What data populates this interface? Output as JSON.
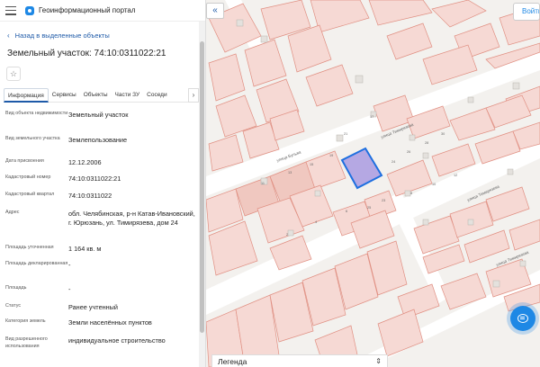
{
  "app": {
    "title": "Геоинформационный портал"
  },
  "nav": {
    "back_label": "Назад в выделенные объекты"
  },
  "object": {
    "title": "Земельный участок: 74:10:0311022:21"
  },
  "tabs": [
    {
      "label": "Информация",
      "active": true
    },
    {
      "label": "Сервисы",
      "active": false
    },
    {
      "label": "Объекты",
      "active": false
    },
    {
      "label": "Части ЗУ",
      "active": false
    },
    {
      "label": "Соседи",
      "active": false
    }
  ],
  "properties": [
    {
      "key": "Вид объекта недвижимости",
      "value": "Земельный участок"
    },
    {
      "key": "Вид земельного участка",
      "value": "Землепользование"
    },
    {
      "key": "Дата присвоения",
      "value": "12.12.2006"
    },
    {
      "key": "Кадастровый номер",
      "value": "74:10:0311022:21"
    },
    {
      "key": "Кадастровый квартал",
      "value": "74:10:0311022"
    },
    {
      "key": "Адрес",
      "value": "обл. Челябинская, р-н Катав-Ивановский, г. Юрюзань, ул. Тимирязева, дом 24"
    },
    {
      "key": "Площадь уточненная",
      "value": "1 164 кв. м"
    },
    {
      "key": "Площадь декларированная",
      "value": "-"
    },
    {
      "key": "Площадь",
      "value": "-"
    },
    {
      "key": "Статус",
      "value": "Ранее учтенный"
    },
    {
      "key": "Категория земель",
      "value": "Земли населённых пунктов"
    },
    {
      "key": "Вид разрешенного использования",
      "value": "индивидуальное строительство"
    }
  ],
  "map": {
    "login_label": "Войти",
    "collapse_symbol": "«",
    "legend_label": "Легенда",
    "legend_arrow": "⇕",
    "streets": [
      "улица Бульва",
      "улица Тимирязева",
      "улица Тимирязева",
      "улица Тимирязева"
    ],
    "parcel_numbers": [
      "21",
      "17",
      "24",
      "26",
      "28",
      "30",
      "11",
      "13",
      "15",
      "19",
      "25",
      "23",
      "2",
      "4",
      "6",
      "8",
      "10",
      "12"
    ],
    "colors": {
      "parcel_fill": "#f6d9d4",
      "parcel_stroke": "#e08f82",
      "selected_fill": "#a99be0",
      "selected_stroke": "#1e6fe0",
      "road": "#ffffff",
      "background": "#f3f1ee"
    }
  },
  "icons": {
    "menu": "hamburger-icon",
    "logo": "portal-logo-icon",
    "back": "chevron-left-icon",
    "star": "star-icon",
    "tab_next": "chevron-right-icon",
    "chat": "chat-icon"
  }
}
